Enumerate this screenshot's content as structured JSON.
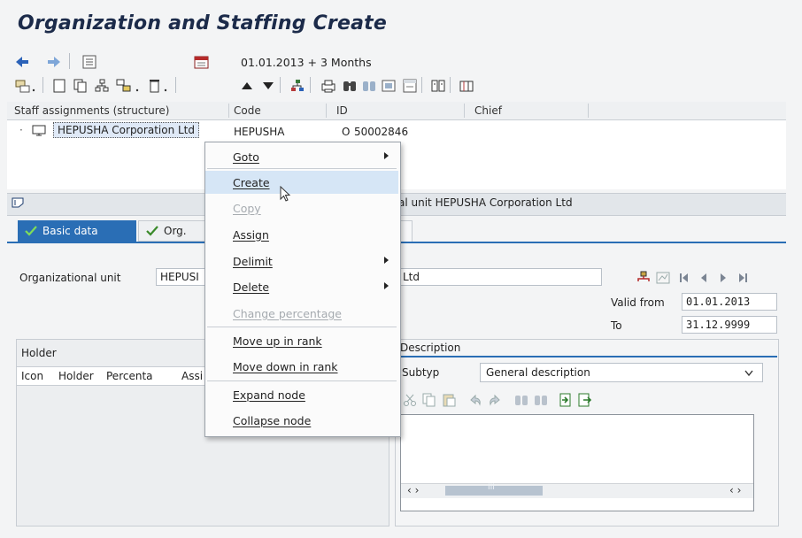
{
  "title": "Organization and Staffing Create",
  "toolbar": {
    "date_info": "01.01.2013 + 3 Months"
  },
  "tree": {
    "columns": [
      "Staff assignments (structure)",
      "Code",
      "ID",
      "Chief"
    ],
    "row": {
      "name": "HEPUSHA Corporation Ltd",
      "code": "HEPUSHA",
      "id_type": "O",
      "id": "50002846"
    }
  },
  "info_bar": {
    "text": "al unit HEPUSHA Corporation Ltd"
  },
  "tabs": {
    "basic": "Basic data",
    "org": "Org."
  },
  "form": {
    "org_unit_label": "Organizational unit",
    "org_unit_value": "HEPUSI",
    "org_unit_desc": "Ltd",
    "valid_from_label": "Valid from",
    "valid_from": "01.01.2013",
    "to_label": "To",
    "to": "31.12.9999"
  },
  "holder": {
    "title": "Holder",
    "columns": [
      "Icon",
      "Holder",
      "Percenta",
      "Assi"
    ]
  },
  "description": {
    "title": "Description",
    "subtyp_label": "Subtyp",
    "subtyp_value": "General description",
    "scroll_left": "‹ ›",
    "scroll_right": "‹ ›",
    "scroll_mid": "III"
  },
  "context_menu": {
    "items": [
      {
        "label": "Goto",
        "submenu": true
      },
      {
        "label": "Create",
        "hover": true
      },
      {
        "label": "Copy",
        "disabled": true
      },
      {
        "label": "Assign"
      },
      {
        "label": "Delimit",
        "submenu": true
      },
      {
        "label": "Delete",
        "submenu": true
      },
      {
        "label": "Change percentage",
        "disabled": true
      },
      {
        "label": "Move up in rank"
      },
      {
        "label": "Move down in rank"
      },
      {
        "label": "Expand node"
      },
      {
        "label": "Collapse node"
      }
    ]
  },
  "colors": {
    "accent": "#2a6eb5",
    "check": "#3a8a2a",
    "title": "#1c2b4a"
  }
}
